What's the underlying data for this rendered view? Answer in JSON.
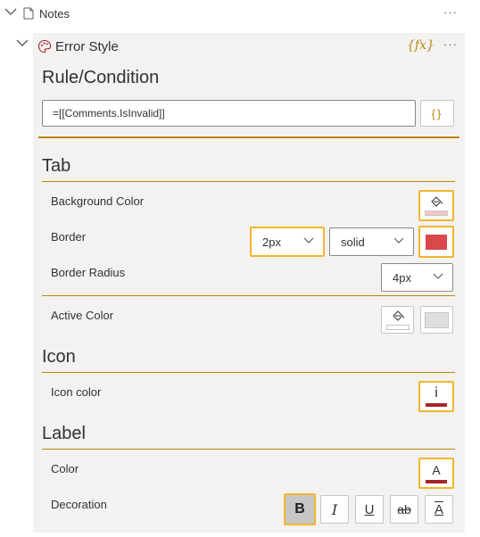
{
  "tree": {
    "notes_label": "Notes",
    "error_style_label": "Error Style",
    "fx_label": "{fx}",
    "more_label": "···"
  },
  "rule": {
    "title": "Rule/Condition",
    "input_value": "=[[Comments.IsInvalid]]",
    "braces_label": "{}"
  },
  "tab": {
    "title": "Tab",
    "background_color_label": "Background Color",
    "border_label": "Border",
    "border_width_value": "2px",
    "border_style_value": "solid",
    "border_color": "#d9484a",
    "border_radius_label": "Border Radius",
    "border_radius_value": "4px",
    "background_color_bar": "#f6c4c6",
    "active_color_label": "Active Color",
    "active_color_swatch": "#e1dfdd"
  },
  "icon": {
    "title": "Icon",
    "icon_color_label": "Icon color",
    "icon_glyph": "i",
    "icon_color_bar": "#a4262c"
  },
  "label": {
    "title": "Label",
    "color_label": "Color",
    "color_glyph": "A",
    "color_bar": "#a4262c",
    "decoration_label": "Decoration",
    "bold": "B",
    "italic": "I",
    "underline": "U",
    "strike": "ab",
    "overline": "A"
  },
  "colors": {
    "accent_gold": "#b8860b",
    "highlight": "#f2b530",
    "panel_bg": "#f3f2f1"
  }
}
